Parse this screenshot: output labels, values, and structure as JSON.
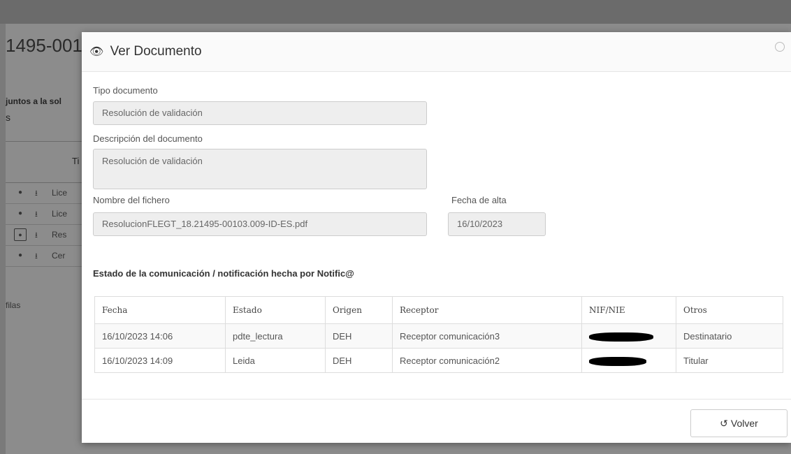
{
  "background": {
    "title": "1495-001",
    "subtitle": "juntos a la sol",
    "dot": "s",
    "table_header": "Ti",
    "rows": [
      "Lice",
      "Lice",
      "Res",
      "Cer"
    ],
    "footer": "filas"
  },
  "modal": {
    "title": "Ver Documento",
    "eye_icon": "👁",
    "fields": {
      "tipo_label": "Tipo documento",
      "tipo_value": "Resolución de validación",
      "desc_label": "Descripción del documento",
      "desc_value": "Resolución de validación",
      "fichero_label": "Nombre del fichero",
      "fichero_value": "ResolucionFLEGT_18.21495-00103.009-ID-ES.pdf",
      "fecha_label": "Fecha de alta",
      "fecha_value": "16/10/2023"
    },
    "section_title": "Estado de la comunicación / notificación hecha por Notific@",
    "table": {
      "headers": [
        "Fecha",
        "Estado",
        "Origen",
        "Receptor",
        "NIF/NIE",
        "Otros"
      ],
      "rows": [
        [
          "16/10/2023 14:06",
          "pdte_lectura",
          "DEH",
          "Receptor comunicación3",
          "",
          "Destinatario"
        ],
        [
          "16/10/2023 14:09",
          "Leida",
          "DEH",
          "Receptor comunicación2",
          "",
          "Titular"
        ]
      ]
    },
    "volver_label": "Volver",
    "volver_icon": "↺"
  }
}
